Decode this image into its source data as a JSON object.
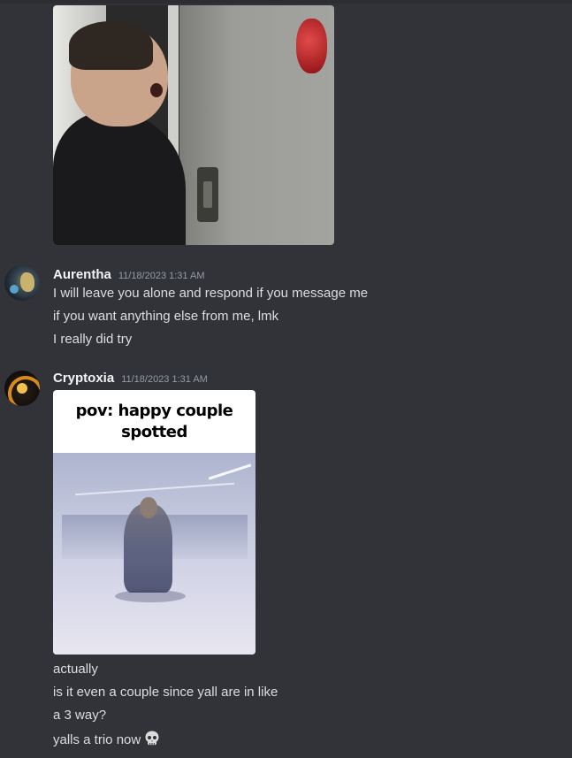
{
  "messages": [
    {
      "username": "Aurentha",
      "timestamp": "11/18/2023 1:31 AM",
      "lines": [
        "I will leave you alone and respond if you message me",
        "if you want anything else from me, lmk",
        "I really did try"
      ]
    },
    {
      "username": "Cryptoxia",
      "timestamp": "11/18/2023 1:31 AM",
      "meme_caption": "pov: happy couple spotted",
      "lines": [
        "actually",
        "is it even a couple since yall are in like",
        "a 3 way?",
        "yalls a trio now"
      ],
      "emoji": "skull-emoji"
    }
  ],
  "colors": {
    "background": "#313338",
    "username": "#f2f3f5",
    "timestamp": "#949ba4",
    "text": "#dbdee1"
  }
}
